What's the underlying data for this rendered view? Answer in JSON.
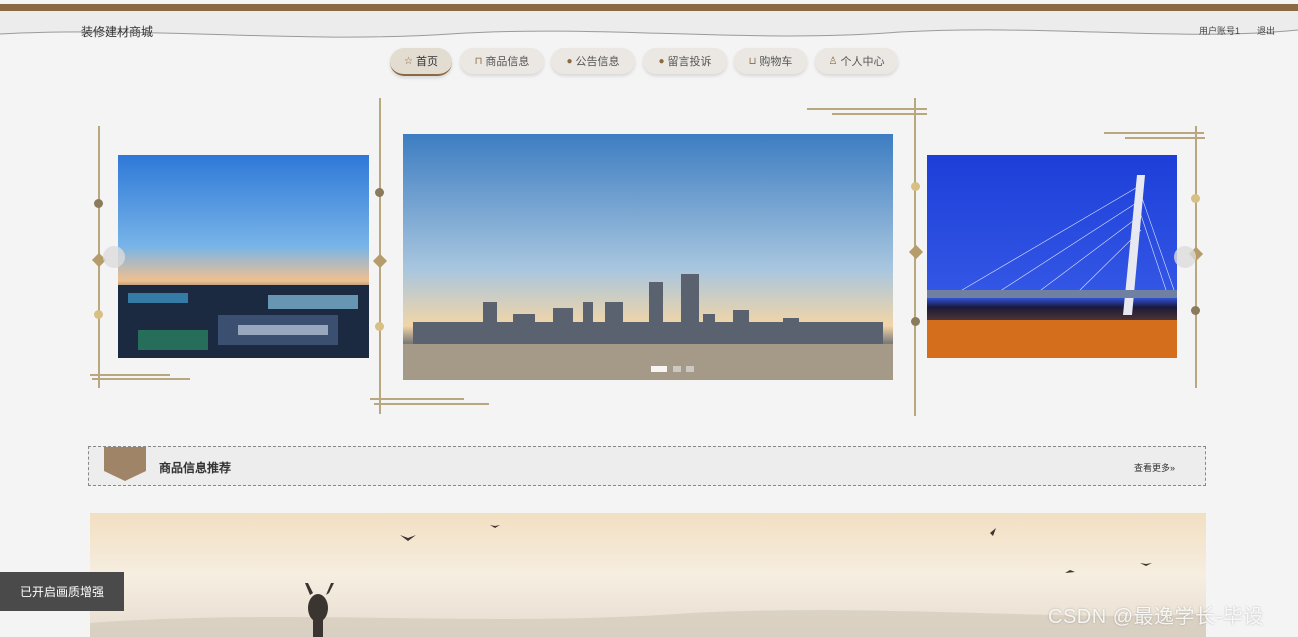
{
  "header": {
    "site_title": "装修建材商城",
    "user_account": "用户账号1",
    "logout": "退出"
  },
  "nav": {
    "items": [
      {
        "label": "首页",
        "icon": "star-icon",
        "active": true
      },
      {
        "label": "商品信息",
        "icon": "bag-icon"
      },
      {
        "label": "公告信息",
        "icon": "notice-icon"
      },
      {
        "label": "留言投诉",
        "icon": "question-icon"
      },
      {
        "label": "购物车",
        "icon": "cart-icon"
      },
      {
        "label": "个人中心",
        "icon": "user-icon"
      }
    ]
  },
  "carousel": {
    "slides": [
      {
        "name": "city-night-waterfront"
      },
      {
        "name": "city-skyline-sunset"
      },
      {
        "name": "cable-stayed-bridge-night"
      }
    ],
    "pages": 3,
    "current_page": 1
  },
  "section": {
    "title": "商品信息推荐",
    "more": "查看更多"
  },
  "overlay": {
    "quality_toast": "已开启画质增强",
    "watermark": "CSDN @最逸学长-毕设"
  },
  "colors": {
    "accent": "#8b6a43",
    "deco_gold": "#b9a77f"
  }
}
